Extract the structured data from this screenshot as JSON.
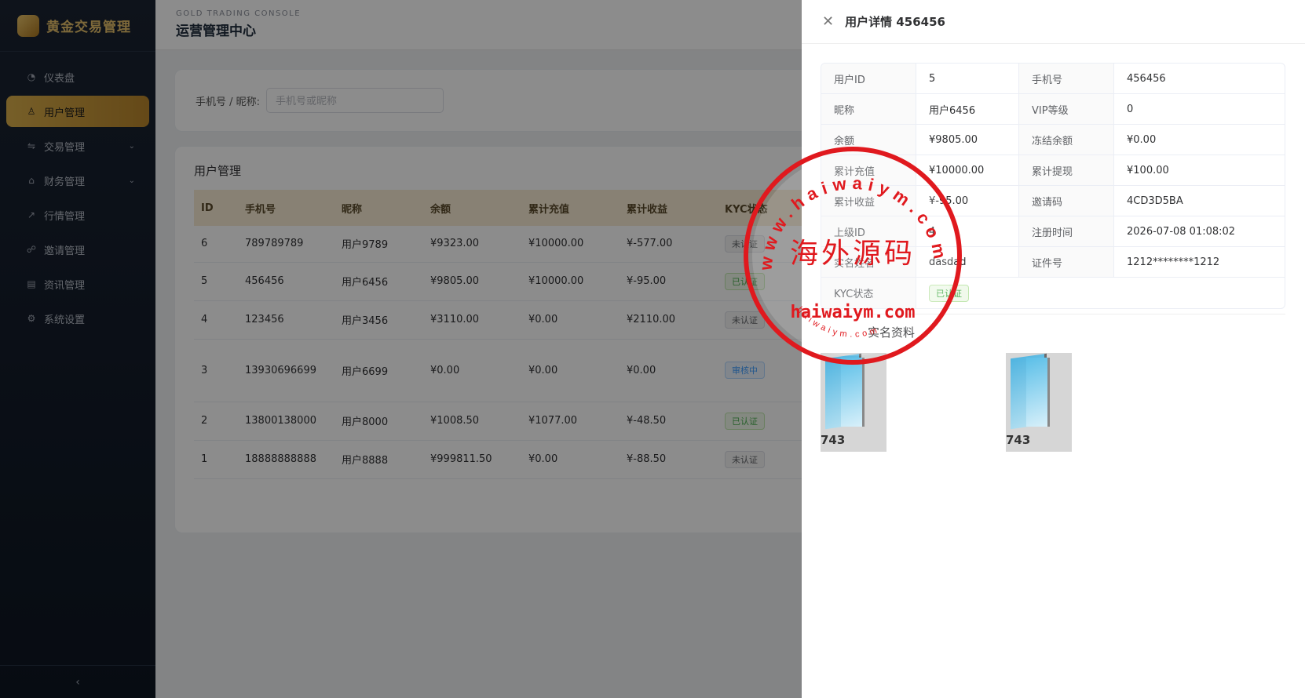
{
  "brand": {
    "name": "黄金交易管理"
  },
  "header": {
    "subtitle": "GOLD TRADING CONSOLE",
    "title": "运营管理中心"
  },
  "sidebar": {
    "items": [
      {
        "label": "仪表盘",
        "icon": "dashboard-icon"
      },
      {
        "label": "用户管理",
        "icon": "user-icon",
        "active": true
      },
      {
        "label": "交易管理",
        "icon": "exchange-icon",
        "expandable": true
      },
      {
        "label": "财务管理",
        "icon": "bank-icon",
        "expandable": true
      },
      {
        "label": "行情管理",
        "icon": "chart-icon"
      },
      {
        "label": "邀请管理",
        "icon": "invite-icon"
      },
      {
        "label": "资讯管理",
        "icon": "document-icon"
      },
      {
        "label": "系统设置",
        "icon": "gear-icon"
      }
    ],
    "collapse_label": "‹"
  },
  "search": {
    "label": "手机号 / 昵称:",
    "placeholder": "手机号或昵称"
  },
  "table": {
    "title": "用户管理",
    "columns": [
      "ID",
      "手机号",
      "昵称",
      "余额",
      "累计充值",
      "累计收益",
      "KYC状态"
    ],
    "rows": [
      [
        "6",
        "789789789",
        "用户9789",
        "¥9323.00",
        "¥10000.00",
        "¥-577.00",
        "未认证"
      ],
      [
        "5",
        "456456",
        "用户6456",
        "¥9805.00",
        "¥10000.00",
        "¥-95.00",
        "已认证"
      ],
      [
        "4",
        "123456",
        "用户3456",
        "¥3110.00",
        "¥0.00",
        "¥2110.00",
        "未认证"
      ],
      [
        "3",
        "13930696699",
        "用户6699",
        "¥0.00",
        "¥0.00",
        "¥0.00",
        "审核中"
      ],
      [
        "2",
        "13800138000",
        "用户8000",
        "¥1008.50",
        "¥1077.00",
        "¥-48.50",
        "已认证"
      ],
      [
        "1",
        "18888888888",
        "用户8888",
        "¥999811.50",
        "¥0.00",
        "¥-88.50",
        "未认证"
      ]
    ]
  },
  "drawer": {
    "title": "用户详情 456456",
    "fields": [
      [
        "用户ID",
        "5",
        "手机号",
        "456456"
      ],
      [
        "昵称",
        "用户6456",
        "VIP等级",
        "0"
      ],
      [
        "余额",
        "¥9805.00",
        "冻结余额",
        "¥0.00"
      ],
      [
        "累计充值",
        "¥10000.00",
        "累计提现",
        "¥100.00"
      ],
      [
        "累计收益",
        "¥-95.00",
        "邀请码",
        "4CD3D5BA"
      ],
      [
        "上级ID",
        "4",
        "注册时间",
        "2026-07-08 01:08:02"
      ],
      [
        "实名姓名",
        "dasdad",
        "证件号",
        "1212********1212"
      ]
    ],
    "kyc_label": "KYC状态",
    "kyc_value": "已认证",
    "section_title": "实名资料",
    "images": [
      {
        "caption": "743"
      },
      {
        "caption": "743"
      }
    ]
  },
  "watermark": {
    "top_arc": "www.haiwaiym.com",
    "center": "海外源码",
    "bottom": "haiwaiym.com",
    "small": "haiwaiym.com"
  }
}
